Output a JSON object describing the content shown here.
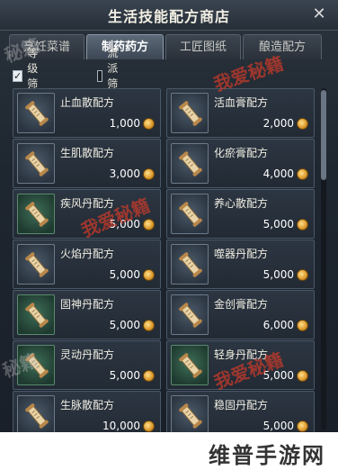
{
  "window": {
    "title": "生活技能配方商店",
    "close_icon": "close-icon"
  },
  "tabs": [
    {
      "label": "烹饪菜谱",
      "active": false
    },
    {
      "label": "制药药方",
      "active": true
    },
    {
      "label": "工匠图纸",
      "active": false
    },
    {
      "label": "酿造配方",
      "active": false
    }
  ],
  "filters": [
    {
      "label": "等级筛选",
      "checked": true
    },
    {
      "label": "流派筛选",
      "checked": false
    }
  ],
  "items": [
    {
      "name": "止血散配方",
      "price": "1,000",
      "icon": "scroll-icon",
      "frame": "gray"
    },
    {
      "name": "活血膏配方",
      "price": "2,000",
      "icon": "scroll-icon",
      "frame": "gray"
    },
    {
      "name": "生肌散配方",
      "price": "3,000",
      "icon": "scroll-icon",
      "frame": "gray"
    },
    {
      "name": "化瘀膏配方",
      "price": "4,000",
      "icon": "scroll-icon",
      "frame": "gray"
    },
    {
      "name": "疾风丹配方",
      "price": "5,000",
      "icon": "scroll-icon",
      "frame": "green"
    },
    {
      "name": "养心散配方",
      "price": "5,000",
      "icon": "scroll-icon",
      "frame": "gray"
    },
    {
      "name": "火焰丹配方",
      "price": "5,000",
      "icon": "scroll-icon",
      "frame": "gray"
    },
    {
      "name": "噬器丹配方",
      "price": "5,000",
      "icon": "scroll-icon",
      "frame": "gray"
    },
    {
      "name": "固神丹配方",
      "price": "5,000",
      "icon": "scroll-icon",
      "frame": "green"
    },
    {
      "name": "金创膏配方",
      "price": "6,000",
      "icon": "scroll-icon",
      "frame": "gray"
    },
    {
      "name": "灵动丹配方",
      "price": "5,000",
      "icon": "scroll-icon",
      "frame": "green"
    },
    {
      "name": "轻身丹配方",
      "price": "5,000",
      "icon": "scroll-icon",
      "frame": "green"
    },
    {
      "name": "生脉散配方",
      "price": "10,000",
      "icon": "scroll-icon",
      "frame": "gray"
    },
    {
      "name": "稳固丹配方",
      "price": "5,000",
      "icon": "scroll-icon",
      "frame": "gray"
    }
  ],
  "currency_icon": "coin-icon",
  "watermarks": {
    "red": "我爱秘籍",
    "gray": "秘籍"
  },
  "footer": {
    "site": "维普手游网"
  }
}
